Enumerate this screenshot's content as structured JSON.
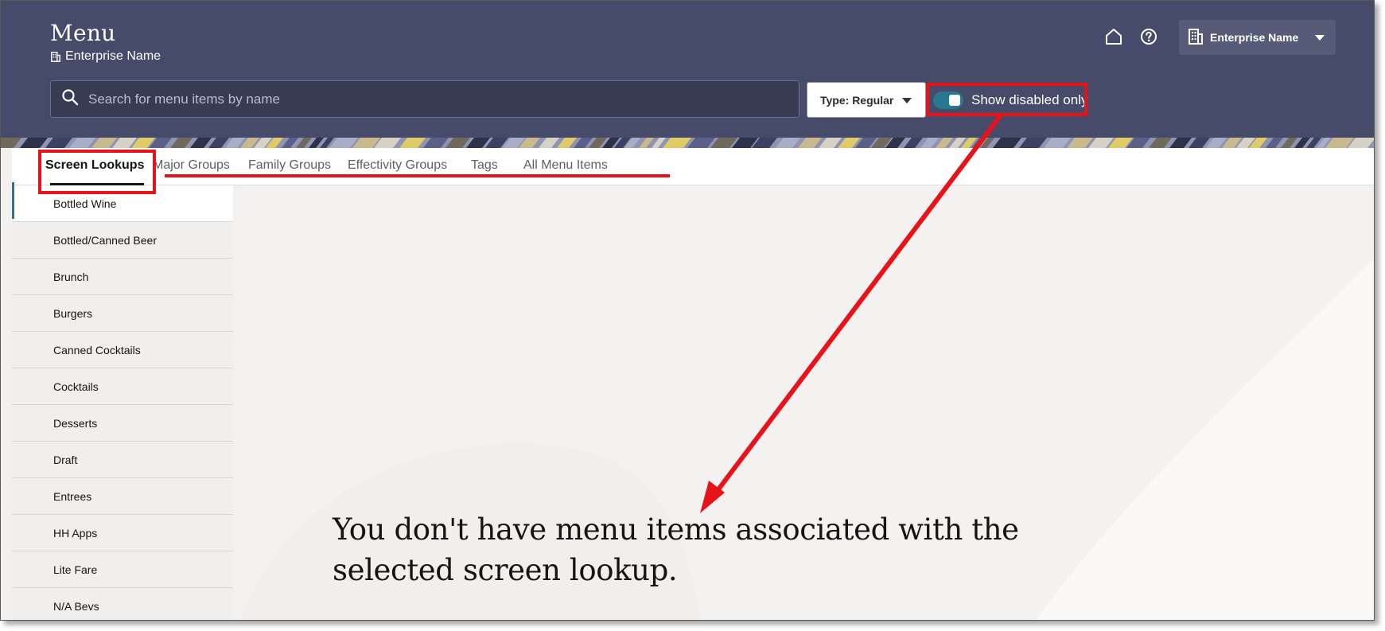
{
  "header": {
    "title": "Menu",
    "subtitle": "Enterprise Name",
    "enterprise_dropdown": "Enterprise Name",
    "home_icon": "home-icon",
    "help_icon": "help-icon",
    "background_color": "#464b69"
  },
  "search": {
    "placeholder": "Search for menu items by name",
    "value": ""
  },
  "type_filter": {
    "label": "Type: Regular"
  },
  "toggle": {
    "label": "Show disabled only",
    "state": "on",
    "accent": "#27788e"
  },
  "tabs": [
    {
      "label": "Screen Lookups",
      "active": true
    },
    {
      "label": "Major Groups",
      "active": false
    },
    {
      "label": "Family Groups",
      "active": false
    },
    {
      "label": "Effectivity Groups",
      "active": false
    },
    {
      "label": "Tags",
      "active": false
    },
    {
      "label": "All Menu Items",
      "active": false
    }
  ],
  "sidebar": {
    "items": [
      "Bottled Wine",
      "Bottled/Canned Beer",
      "Brunch",
      "Burgers",
      "Canned Cocktails",
      "Cocktails",
      "Desserts",
      "Draft",
      "Entrees",
      "HH Apps",
      "Lite Fare",
      "N/A Bevs"
    ],
    "selected": "Bottled Wine"
  },
  "main": {
    "empty_message": "You don't have menu items associated with the selected screen lookup."
  },
  "annotations": {
    "highlight_color": "#e8121b"
  }
}
